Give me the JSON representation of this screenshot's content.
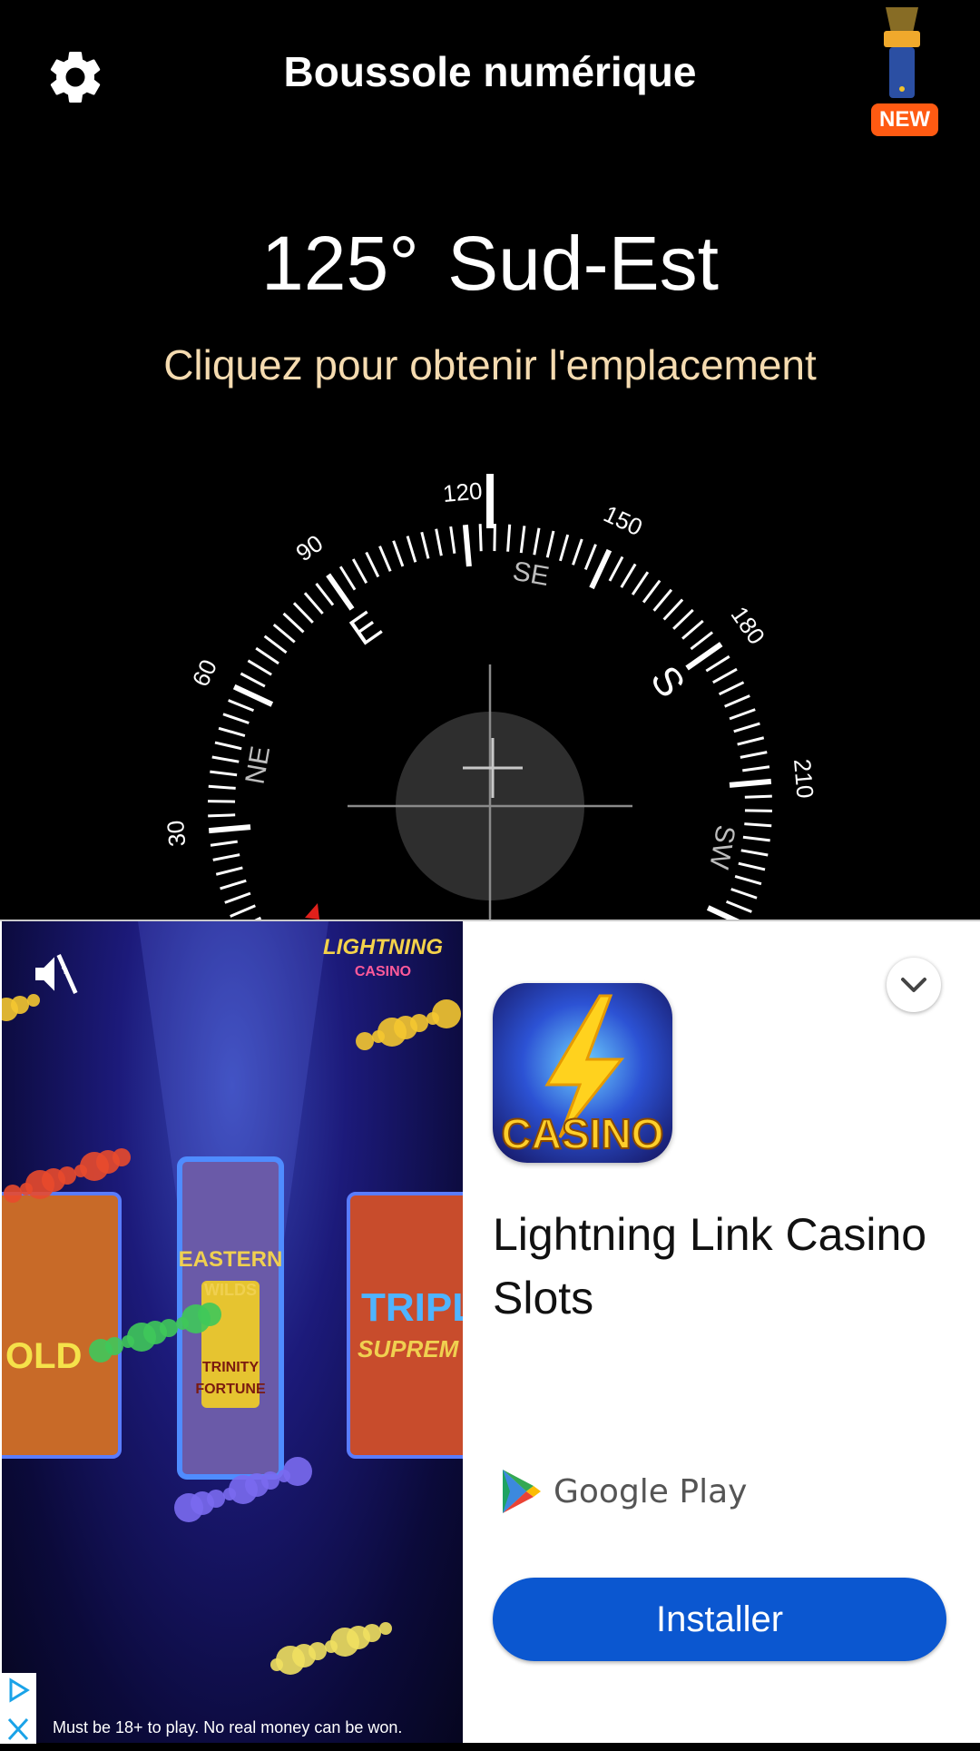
{
  "header": {
    "title": "Boussole numérique",
    "new_badge": "NEW",
    "settings_icon": "gear-icon",
    "flashlight_icon": "flashlight-icon"
  },
  "heading": {
    "degrees": "125°",
    "direction": "Sud-Est"
  },
  "location_link": "Cliquez pour obtenir l'emplacement",
  "compass": {
    "heading_value": 125,
    "degree_labels": [
      "30",
      "60",
      "90",
      "120",
      "150",
      "180",
      "210"
    ],
    "intercardinal_labels": [
      "NE",
      "SE",
      "SW"
    ],
    "cardinal_labels": [
      "E",
      "S"
    ],
    "colors": {
      "dial": "#ffffff",
      "intercardinal": "#bdbdbd",
      "crosshair": "#8a8a8a",
      "bubble": "#2e2e2e",
      "north_marker": "#e0201b"
    }
  },
  "ad": {
    "brand_logo_text": "LIGHTNING CASINO",
    "disclaimer": "Must be 18+ to play. No real money can be won.",
    "game_tiles": [
      "BUFFALO GOLD",
      "EASTERN WILDS",
      "TRINITY of FORTUNE",
      "TRIPLE SUPREME XTREME"
    ],
    "icon_text": "CASINO",
    "title": "Lightning Link Casino Slots",
    "store": "Google Play",
    "install_label": "Installer",
    "mute_icon": "muted-speaker-icon",
    "collapse_icon": "chevron-down-icon",
    "adchoices_icon": "adchoices-icon",
    "close_icon": "close-icon",
    "colors": {
      "install": "#0b57d0",
      "badge": "#ff5a12",
      "location": "#f5dbb0"
    }
  }
}
